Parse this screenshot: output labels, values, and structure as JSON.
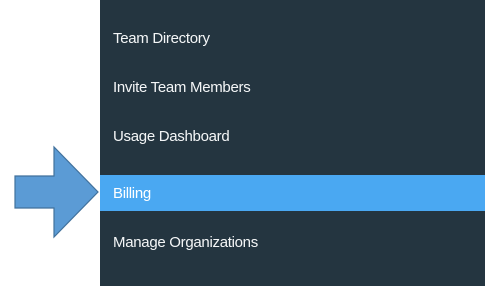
{
  "menu": {
    "items": [
      {
        "label": "Team Directory",
        "active": false
      },
      {
        "label": "Invite Team Members",
        "active": false
      },
      {
        "label": "Usage Dashboard",
        "active": false
      },
      {
        "label": "Billing",
        "active": true
      },
      {
        "label": "Manage Organizations",
        "active": false
      }
    ]
  },
  "annotation": {
    "icon": "arrow-right-icon",
    "fill": "#5b9bd5",
    "stroke": "#41719c"
  },
  "colors": {
    "menu_bg": "#243540",
    "active_bg": "#4aa8f2",
    "text": "#f4f6f7"
  }
}
